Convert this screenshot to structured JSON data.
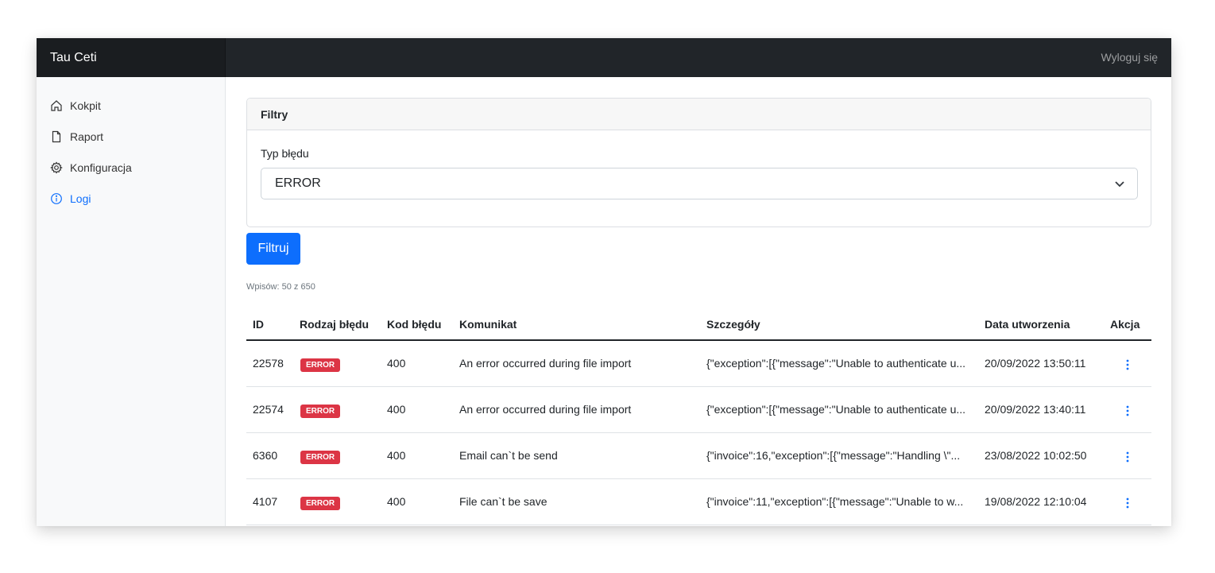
{
  "app": {
    "brand": "Tau Ceti",
    "logout_label": "Wyloguj się"
  },
  "sidebar": {
    "items": [
      {
        "label": "Kokpit",
        "icon": "home-icon",
        "active": false
      },
      {
        "label": "Raport",
        "icon": "file-icon",
        "active": false
      },
      {
        "label": "Konfiguracja",
        "icon": "gear-icon",
        "active": false
      },
      {
        "label": "Logi",
        "icon": "info-circle-icon",
        "active": true
      }
    ]
  },
  "filters": {
    "title": "Filtry",
    "error_type_label": "Typ błędu",
    "error_type_value": "ERROR",
    "submit_label": "Filtruj"
  },
  "summary": {
    "count_text": "Wpisów: 50 z 650"
  },
  "table": {
    "columns": [
      "ID",
      "Rodzaj błędu",
      "Kod błędu",
      "Komunikat",
      "Szczegóły",
      "Data utworzenia",
      "Akcja"
    ],
    "rows": [
      {
        "id": "22578",
        "type": "ERROR",
        "code": "400",
        "message": "An error occurred during file import",
        "details": "{\"exception\":[{\"message\":\"Unable to authenticate u...",
        "created": "20/09/2022 13:50:11"
      },
      {
        "id": "22574",
        "type": "ERROR",
        "code": "400",
        "message": "An error occurred during file import",
        "details": "{\"exception\":[{\"message\":\"Unable to authenticate u...",
        "created": "20/09/2022 13:40:11"
      },
      {
        "id": "6360",
        "type": "ERROR",
        "code": "400",
        "message": "Email can`t be send",
        "details": "{\"invoice\":16,\"exception\":[{\"message\":\"Handling \\\"...",
        "created": "23/08/2022 10:02:50"
      },
      {
        "id": "4107",
        "type": "ERROR",
        "code": "400",
        "message": "File can`t be save",
        "details": "{\"invoice\":11,\"exception\":[{\"message\":\"Unable to w...",
        "created": "19/08/2022 12:10:04"
      }
    ]
  },
  "colors": {
    "primary": "#0d6efd",
    "danger": "#dc3545",
    "topbar": "#212529"
  }
}
